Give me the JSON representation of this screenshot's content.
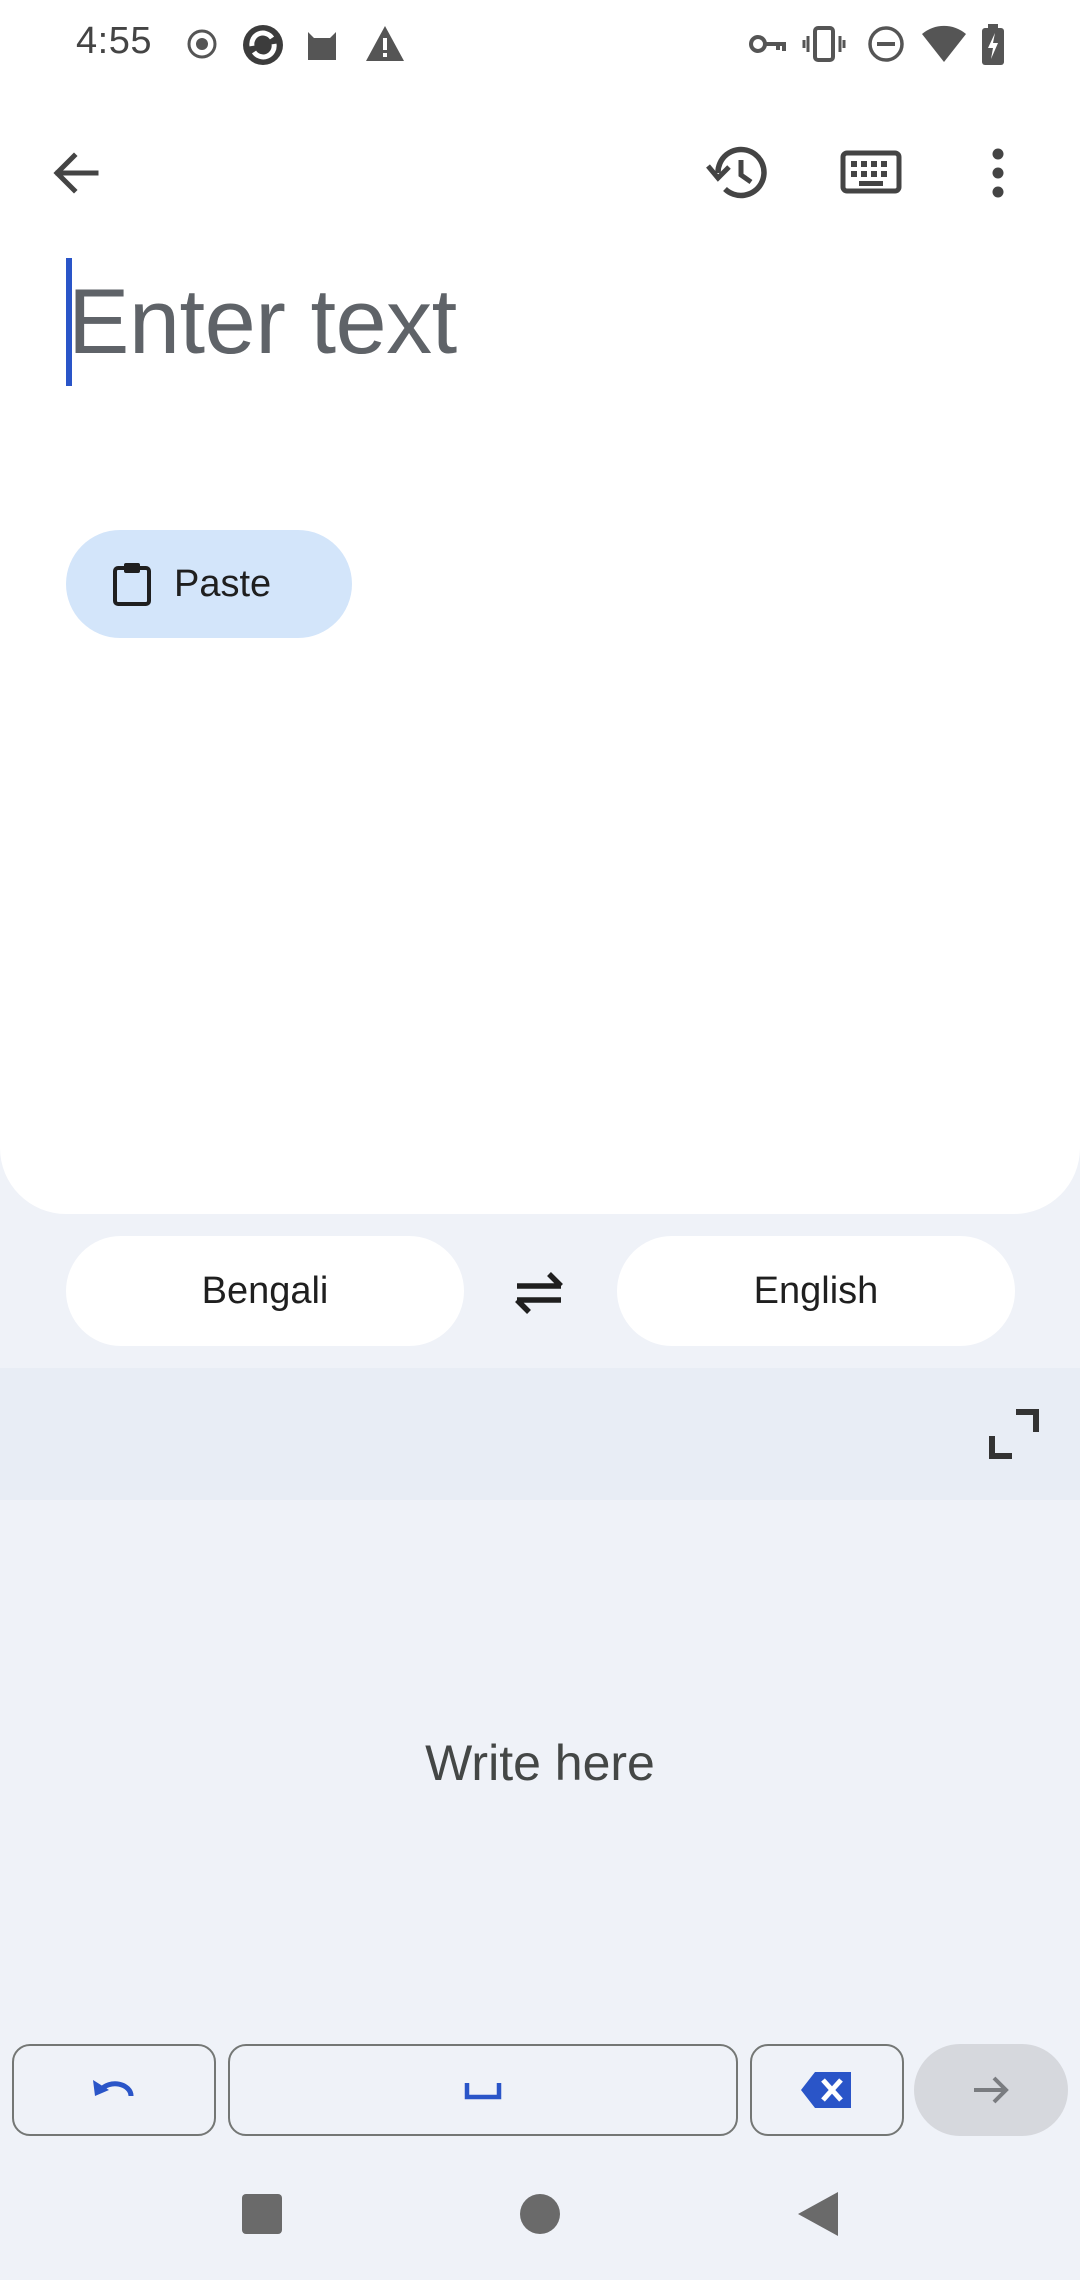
{
  "status_bar": {
    "time": "4:55",
    "left_icons": [
      "record-icon",
      "sync-app-icon",
      "cat-app-icon",
      "warning-icon"
    ],
    "right_icons": [
      "vpn-key-icon",
      "vibrate-icon",
      "do-not-disturb-icon",
      "wifi-icon",
      "battery-charging-icon"
    ]
  },
  "toolbar": {
    "icons": [
      "arrow-back-icon",
      "history-icon",
      "keyboard-icon",
      "more-vert-icon"
    ]
  },
  "input": {
    "placeholder": "Enter text",
    "paste_label": "Paste"
  },
  "languages": {
    "source": "Bengali",
    "target": "English"
  },
  "handwriting": {
    "prompt": "Write here"
  },
  "keys": {
    "icons": [
      "undo-icon",
      "space-icon",
      "backspace-icon",
      "arrow-forward-icon"
    ]
  },
  "colors": {
    "accent": "#2a55c8",
    "paste_bg": "#d3e5fa",
    "surface": "#eff2f8",
    "card": "#ffffff"
  }
}
